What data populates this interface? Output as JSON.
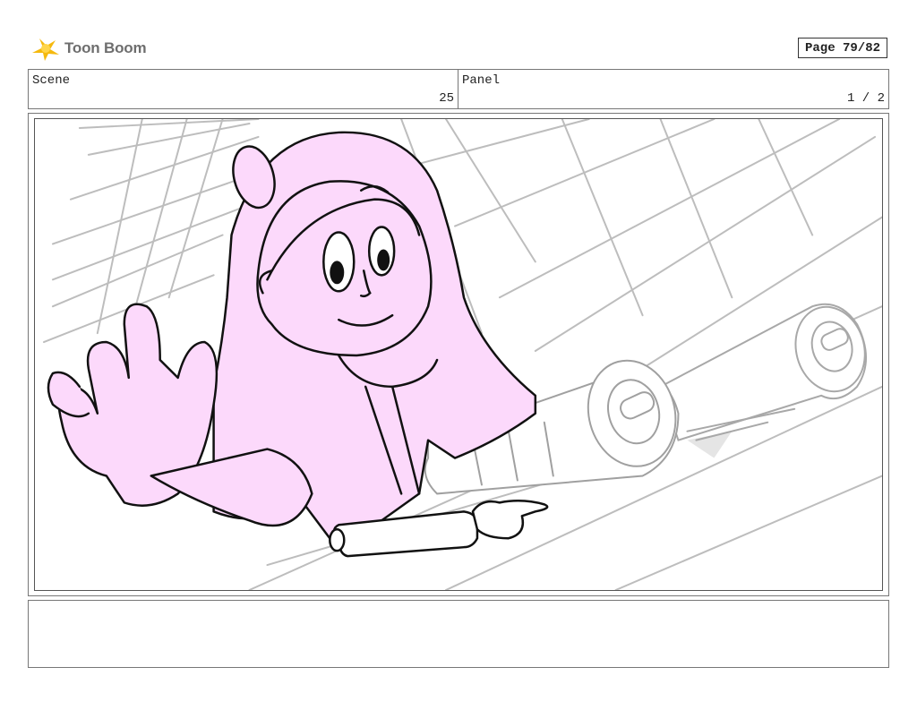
{
  "header": {
    "logo_text": "Toon Boom",
    "page_label": "Page 79/82"
  },
  "info": {
    "scene_label": "Scene",
    "scene_value": "25",
    "panel_label": "Panel",
    "panel_value": "1 / 2"
  },
  "panel": {
    "illustration": "storyboard-sketch-girl-with-scrolls",
    "highlight_color": "#fcd9fb"
  },
  "notes": {
    "text": ""
  }
}
